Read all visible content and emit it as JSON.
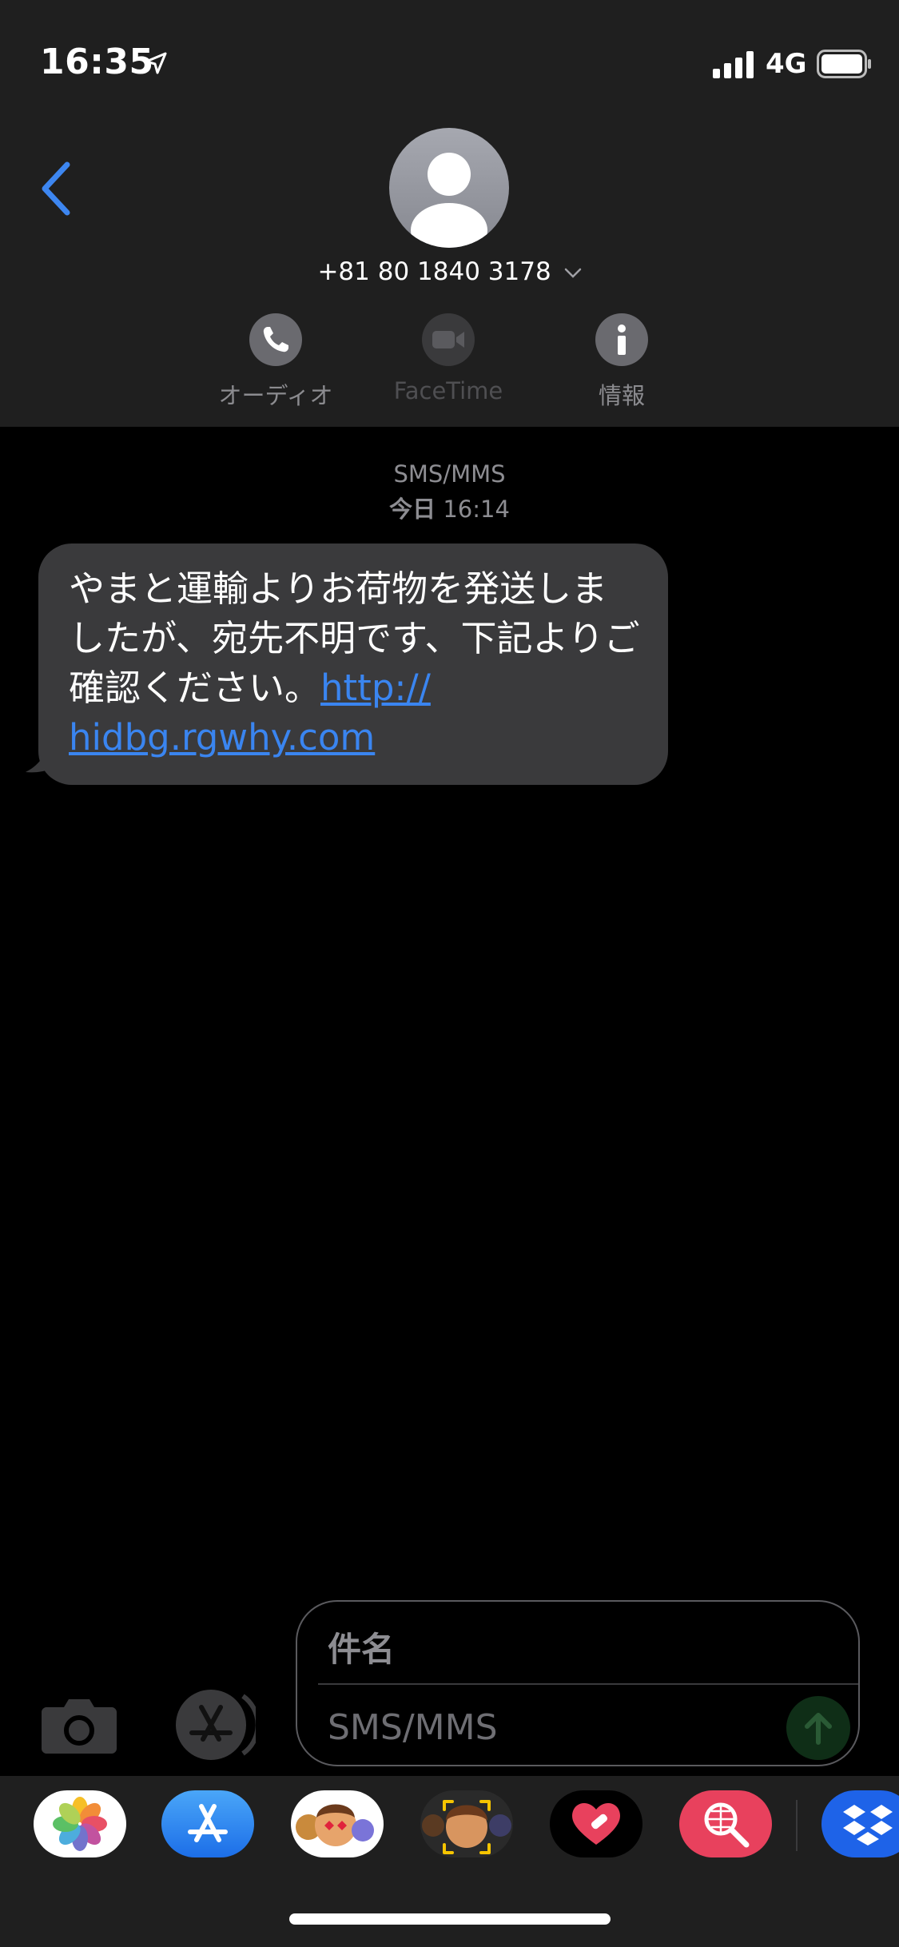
{
  "status_bar": {
    "time": "16:35",
    "network": "4G",
    "icons": [
      "location-arrow-icon",
      "signal-icon",
      "battery-icon"
    ]
  },
  "header": {
    "back_icon": "chevron-left-icon",
    "contact_number": "+81 80 1840 3178",
    "contact_chevron": "⌵",
    "actions": [
      {
        "label": "オーディオ",
        "icon": "phone-icon"
      },
      {
        "label": "FaceTime",
        "icon": "video-camera-icon"
      },
      {
        "label": "情報",
        "icon": "info-icon"
      }
    ]
  },
  "thread": {
    "service": "SMS/MMS",
    "timestamp_day": "今日",
    "timestamp_time": "16:14",
    "message": {
      "text": "やまと運輸よりお荷物を発送しましたが、宛先不明です、下記よりご確認ください。",
      "link": "http://hidbg.rgwhy.com",
      "link_line1": "http://",
      "link_line2": "hidbg.rgwhy.com"
    }
  },
  "composer": {
    "subject_placeholder": "件名",
    "message_placeholder": "SMS/MMS",
    "icons": [
      "camera-icon",
      "app-store-icon",
      "send-arrow-icon"
    ]
  },
  "app_drawer": {
    "apps": [
      "photos-app-icon",
      "app-store-app-icon",
      "memoji-stickers-icon",
      "memoji-icon",
      "heart-sticker-icon",
      "image-search-icon",
      "dropbox-icon"
    ]
  },
  "colors": {
    "link": "#3a85f0",
    "bubble": "#3a3a3c",
    "header_bg": "#1f1f1f",
    "accent_blue": "#3d86f0"
  }
}
